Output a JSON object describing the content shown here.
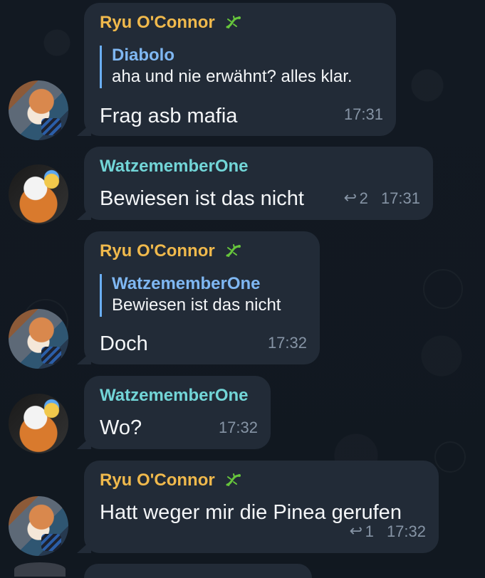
{
  "messages": [
    {
      "sender": "Ryu O'Connor",
      "reply_to_name": "Diabolo",
      "reply_to_text": "aha und nie erwähnt? alles klar.",
      "text": "Frag asb mafia",
      "time": "17:31"
    },
    {
      "sender": "WatzememberOne",
      "text": "Bewiesen ist das nicht",
      "reply_count": "2",
      "time": "17:31"
    },
    {
      "sender": "Ryu O'Connor",
      "reply_to_name": "WatzememberOne",
      "reply_to_text": "Bewiesen ist das nicht",
      "text": "Doch",
      "time": "17:32"
    },
    {
      "sender": "WatzememberOne",
      "text": "Wo?",
      "time": "17:32"
    },
    {
      "sender": "Ryu O'Connor",
      "text": "Hatt weger mir die Pinea gerufen",
      "reply_count": "1",
      "time": "17:32"
    }
  ],
  "icons": {
    "sender_badge": "lizard-icon",
    "reply_count": "reply-arrow-icon"
  },
  "colors": {
    "background": "#111821",
    "bubble": "#222b37",
    "ryu_name": "#f0b94c",
    "watze_name": "#72d5d7",
    "reply_accent": "#6aaef4",
    "meta": "#8694a5"
  }
}
